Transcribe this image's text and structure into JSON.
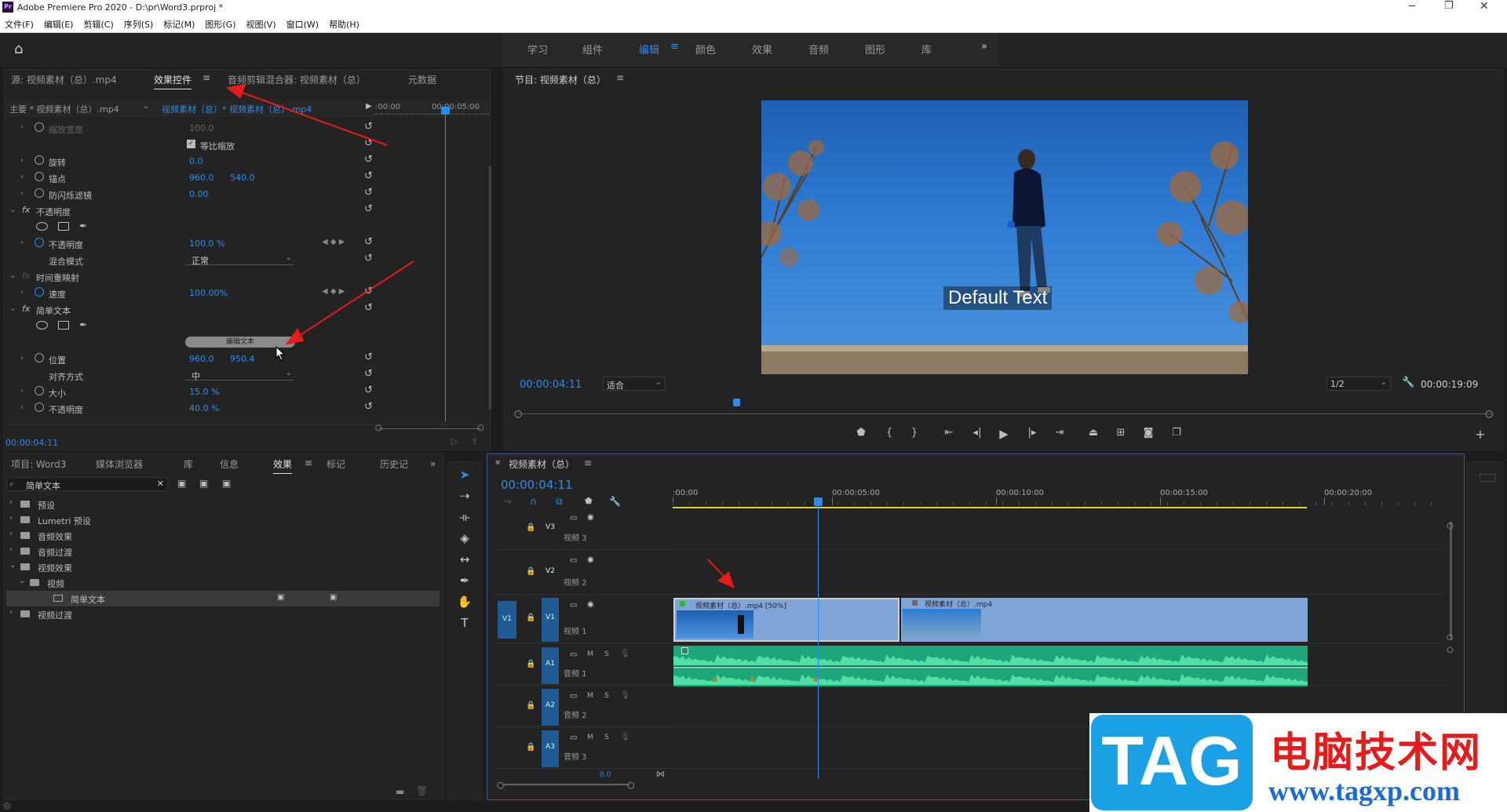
{
  "window": {
    "title": "Adobe Premiere Pro 2020 - D:\\pr\\Word3.prproj *",
    "app_icon": "Pr"
  },
  "menu": [
    "文件(F)",
    "编辑(E)",
    "剪辑(C)",
    "序列(S)",
    "标记(M)",
    "图形(G)",
    "视图(V)",
    "窗口(W)",
    "帮助(H)"
  ],
  "workspaces": [
    "学习",
    "组件",
    "编辑",
    "颜色",
    "效果",
    "音频",
    "图形",
    "库"
  ],
  "workspace_active": "编辑",
  "source_panel": {
    "tabs": [
      "源: 视频素材（总）.mp4",
      "效果控件",
      "音频剪辑混合器: 视频素材（总）",
      "元数据"
    ],
    "active": "效果控件",
    "clip_path": "主要 * 视频素材（总）.mp4",
    "seq_path": "视频素材（总）* 视频素材（总）.mp4",
    "ruler_start": ":00:00",
    "ruler_mid": "00:00:05:00",
    "rows": [
      {
        "name": "缩放宽度",
        "v1": "100.0",
        "dim": true
      },
      {
        "name": "等比缩放",
        "checkbox": true
      },
      {
        "name": "旋转",
        "v1": "0.0"
      },
      {
        "name": "锚点",
        "v1": "960.0",
        "v2": "540.0"
      },
      {
        "name": "防闪烁滤镜",
        "v1": "0.00"
      },
      {
        "name": "不透明度",
        "fx": true
      },
      {
        "name": "mask_tools"
      },
      {
        "name": "不透明度",
        "v1": "100.0 %",
        "keyframe": true
      },
      {
        "name": "混合模式",
        "select": "正常"
      },
      {
        "name": "时间重映射",
        "fx": true,
        "dimfx": true
      },
      {
        "name": "速度",
        "v1": "100.00%",
        "keyframe": true
      },
      {
        "name": "简单文本",
        "fx": true
      },
      {
        "name": "mask_tools"
      },
      {
        "name": "button",
        "label": "编辑文本"
      },
      {
        "name": "位置",
        "v1": "960.0",
        "v2": "950.4"
      },
      {
        "name": "对齐方式",
        "select": "中"
      },
      {
        "name": "大小",
        "v1": "15.0 %"
      },
      {
        "name": "不透明度",
        "v1": "40.0 %"
      }
    ],
    "timecode": "00:00:04:11"
  },
  "program_panel": {
    "title": "节目: 视频素材（总）",
    "timecode": "00:00:04:11",
    "fit": "适合",
    "res": "1/2",
    "duration": "00:00:19:09",
    "overlay_text": "Default Text"
  },
  "project_panel": {
    "tabs": [
      "项目: Word3",
      "媒体浏览器",
      "库",
      "信息",
      "效果",
      "标记",
      "历史记"
    ],
    "active": "效果",
    "search": "简单文本",
    "tree": [
      {
        "label": "预设",
        "level": 0
      },
      {
        "label": "Lumetri 预设",
        "level": 0
      },
      {
        "label": "音频效果",
        "level": 0
      },
      {
        "label": "音频过渡",
        "level": 0
      },
      {
        "label": "视频效果",
        "level": 0,
        "open": true
      },
      {
        "label": "视频",
        "level": 1,
        "open": true
      },
      {
        "label": "简单文本",
        "level": 2,
        "selected": true
      },
      {
        "label": "视频过渡",
        "level": 0
      }
    ]
  },
  "timeline": {
    "title": "视频素材（总）",
    "timecode": "00:00:04:11",
    "ruler": [
      ":00:00",
      "00:00:05:00",
      "00:00:10:00",
      "00:00:15:00",
      "00:00:20:00"
    ],
    "tracks": [
      {
        "id": "V3",
        "name": "视频 3"
      },
      {
        "id": "V2",
        "name": "视频 2"
      },
      {
        "id": "V1",
        "name": "视频 1",
        "src": "V1"
      },
      {
        "id": "A1",
        "name": "音频 1"
      },
      {
        "id": "A2",
        "name": "音频 2"
      },
      {
        "id": "A3",
        "name": "音频 3"
      }
    ],
    "clip1": "视频素材（总）.mp4 [50%]",
    "clip2": "视频素材（总）.mp4",
    "bottom_val": "0.0"
  },
  "watermark": {
    "tag": "TAG",
    "cn": "电脑技术网",
    "url": "www.tagxp.com"
  }
}
